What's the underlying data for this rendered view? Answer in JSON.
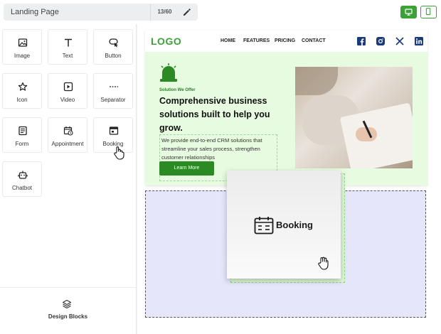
{
  "header": {
    "page_name": "Landing Page",
    "char_count": "13/60",
    "icons": [
      "pencil-icon",
      "desktop-icon",
      "mobile-icon"
    ],
    "accent_color": "#3aa237"
  },
  "elements_panel": {
    "items": [
      {
        "label": "Image",
        "icon": "image-icon"
      },
      {
        "label": "Text",
        "icon": "text-icon"
      },
      {
        "label": "Button",
        "icon": "button-icon"
      },
      {
        "label": "Icon",
        "icon": "star-icon"
      },
      {
        "label": "Video",
        "icon": "video-icon"
      },
      {
        "label": "Separator",
        "icon": "separator-icon"
      },
      {
        "label": "Form",
        "icon": "form-icon"
      },
      {
        "label": "Appointment",
        "icon": "calendar-clock-icon"
      },
      {
        "label": "Booking",
        "icon": "booking-icon"
      },
      {
        "label": "Chatbot",
        "icon": "robot-icon"
      }
    ],
    "footer_label": "Design Blocks"
  },
  "preview": {
    "logo": "LOGO",
    "nav_links": [
      "HOME",
      "FEATURES",
      "PRICING",
      "CONTACT"
    ],
    "social_icons": [
      "facebook-icon",
      "instagram-icon",
      "x-icon",
      "linkedin-icon"
    ],
    "eyebrow": "Solution We Offer",
    "headline": "Comprehensive business solutions built to help you grow.",
    "description": "We provide end-to-end CRM solutions that streamline your sales process, strengthen customer relationships",
    "cta_label": "Learn More",
    "background_color": "#e7fbe0"
  },
  "drag_item": {
    "label": "Booking",
    "icon": "booking-calendar-icon"
  }
}
